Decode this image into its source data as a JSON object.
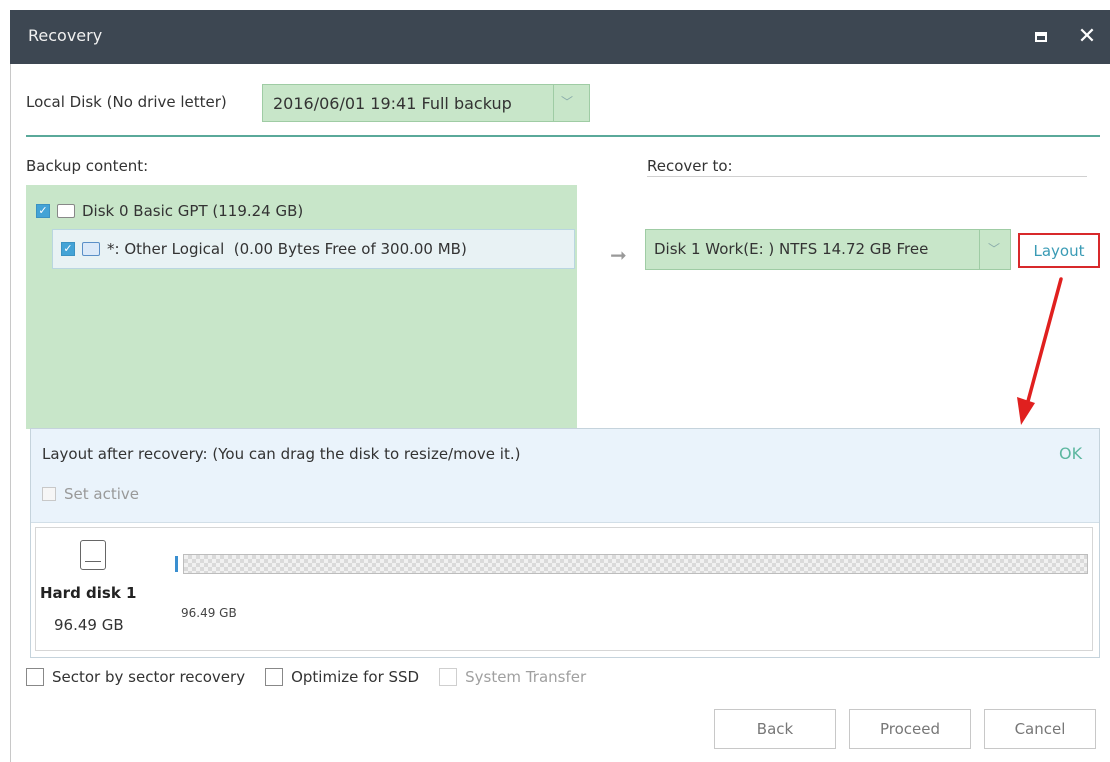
{
  "window": {
    "title": "Recovery",
    "close_glyph": "✕"
  },
  "source": {
    "label": "Local Disk (No drive letter)",
    "backup_selected": "2016/06/01 19:41 Full backup"
  },
  "backup_content": {
    "label": "Backup content:",
    "disk": {
      "label": "Disk 0 Basic GPT (119.24 GB)",
      "checked": true
    },
    "partition": {
      "label": "*: Other Logical  (0.00 Bytes Free of 300.00 MB)",
      "checked": true
    }
  },
  "recover_to": {
    "label": "Recover to:",
    "target_selected": "Disk 1 Work(E: ) NTFS 14.72 GB Free",
    "layout_link": "Layout"
  },
  "layout_panel": {
    "description": "Layout after recovery: (You can drag the disk to resize/move it.)",
    "ok_label": "OK",
    "set_active_label": "Set active",
    "set_active_checked": false,
    "disk_name": "Hard disk 1",
    "disk_size": "96.49 GB",
    "partition_size_label": "96.49 GB"
  },
  "options": [
    {
      "label": "Sector by sector recovery",
      "checked": false,
      "enabled": true
    },
    {
      "label": "Optimize for SSD",
      "checked": false,
      "enabled": true
    },
    {
      "label": "System Transfer",
      "checked": false,
      "enabled": false
    }
  ],
  "buttons": {
    "back": "Back",
    "proceed": "Proceed",
    "cancel": "Cancel"
  },
  "colors": {
    "titlebar": "#3d4752",
    "accent": "#5aa99a",
    "selected_green": "#c8e6c9",
    "annotation_red": "#d8292b",
    "link": "#3a9bb5"
  }
}
